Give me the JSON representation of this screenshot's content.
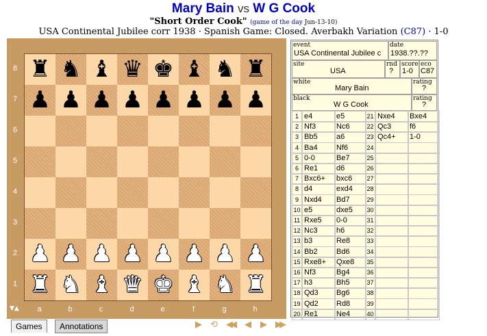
{
  "header": {
    "white": "Mary Bain",
    "vs": "vs",
    "black": "W G Cook",
    "nickname": "\"Short Order Cook\"",
    "gotd_label": "game of the day",
    "gotd_date": "Jun-13-10",
    "event_line": "USA Continental Jubilee corr 1938 · Spanish Game: Closed. Averbakh Variation",
    "eco": "(C87)",
    "result": "· 1-0"
  },
  "board": {
    "rank_labels": [
      "8",
      "7",
      "6",
      "5",
      "4",
      "3",
      "2",
      "1"
    ],
    "file_labels": [
      "a",
      "b",
      "c",
      "d",
      "e",
      "f",
      "g",
      "h"
    ],
    "flip_icon": "▼▲",
    "rows": [
      [
        "bR",
        "bN",
        "bB",
        "bQ",
        "bK",
        "bB",
        "bN",
        "bR"
      ],
      [
        "bP",
        "bP",
        "bP",
        "bP",
        "bP",
        "bP",
        "bP",
        "bP"
      ],
      [
        "",
        "",
        "",
        "",
        "",
        "",
        "",
        ""
      ],
      [
        "",
        "",
        "",
        "",
        "",
        "",
        "",
        ""
      ],
      [
        "",
        "",
        "",
        "",
        "",
        "",
        "",
        ""
      ],
      [
        "",
        "",
        "",
        "",
        "",
        "",
        "",
        ""
      ],
      [
        "wP",
        "wP",
        "wP",
        "wP",
        "wP",
        "wP",
        "wP",
        "wP"
      ],
      [
        "wR",
        "wN",
        "wB",
        "wQ",
        "wK",
        "wB",
        "wN",
        "wR"
      ]
    ]
  },
  "controls": {
    "play_icon": "▶",
    "loop_icon": "⟲",
    "first_icon": "◀◀",
    "prev_icon": "◀",
    "next_icon": "▶",
    "last_icon": "▶▶"
  },
  "tabs": {
    "games": "Games",
    "annotations": "Annotations"
  },
  "info": {
    "event_label": "event",
    "event": "USA Continental Jubilee c",
    "date_label": "date",
    "date": "1938.??.??",
    "site_label": "site",
    "site": "USA",
    "rnd_label": "rnd",
    "rnd": "?",
    "score_label": "score",
    "score": "1-0",
    "eco_label": "eco",
    "eco": "C87",
    "white_label": "white",
    "white": "Mary Bain",
    "white_rating_label": "rating",
    "white_rating": "?",
    "black_label": "black",
    "black": "W G Cook",
    "black_rating_label": "rating",
    "black_rating": "?"
  },
  "moves": [
    [
      "1",
      "e4",
      "e5"
    ],
    [
      "2",
      "Nf3",
      "Nc6"
    ],
    [
      "3",
      "Bb5",
      "a6"
    ],
    [
      "4",
      "Ba4",
      "Nf6"
    ],
    [
      "5",
      "0-0",
      "Be7"
    ],
    [
      "6",
      "Re1",
      "d6"
    ],
    [
      "7",
      "Bxc6+",
      "bxc6"
    ],
    [
      "8",
      "d4",
      "exd4"
    ],
    [
      "9",
      "Nxd4",
      "Bd7"
    ],
    [
      "10",
      "e5",
      "dxe5"
    ],
    [
      "11",
      "Rxe5",
      "0-0"
    ],
    [
      "12",
      "Nc3",
      "h6"
    ],
    [
      "13",
      "b3",
      "Re8"
    ],
    [
      "14",
      "Bb2",
      "Bd6"
    ],
    [
      "15",
      "Rxe8+",
      "Qxe8"
    ],
    [
      "16",
      "Nf3",
      "Bg4"
    ],
    [
      "17",
      "h3",
      "Bh5"
    ],
    [
      "18",
      "Qd3",
      "Bg6"
    ],
    [
      "19",
      "Qd2",
      "Rd8"
    ],
    [
      "20",
      "Re1",
      "Ne4"
    ],
    [
      "21",
      "Nxe4",
      "Bxe4"
    ],
    [
      "22",
      "Qc3",
      "f6"
    ],
    [
      "23",
      "Qc4+",
      "1-0"
    ],
    [
      "24",
      "",
      ""
    ],
    [
      "25",
      "",
      ""
    ],
    [
      "26",
      "",
      ""
    ],
    [
      "27",
      "",
      ""
    ],
    [
      "28",
      "",
      ""
    ],
    [
      "29",
      "",
      ""
    ],
    [
      "30",
      "",
      ""
    ],
    [
      "31",
      "",
      ""
    ],
    [
      "32",
      "",
      ""
    ],
    [
      "33",
      "",
      ""
    ],
    [
      "34",
      "",
      ""
    ],
    [
      "35",
      "",
      ""
    ],
    [
      "36",
      "",
      ""
    ],
    [
      "37",
      "",
      ""
    ],
    [
      "38",
      "",
      ""
    ],
    [
      "39",
      "",
      ""
    ],
    [
      "40",
      "",
      ""
    ]
  ]
}
